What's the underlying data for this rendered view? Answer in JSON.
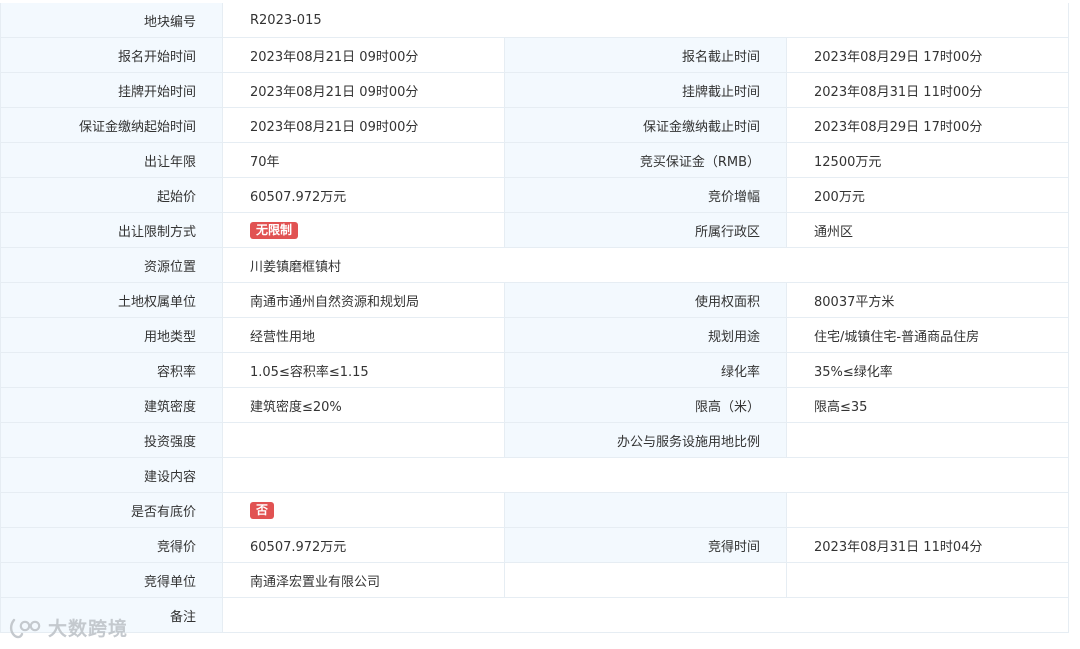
{
  "rows": [
    {
      "full": true,
      "label": "地块编号",
      "value": "R2023-015"
    },
    {
      "label": "报名开始时间",
      "value": "2023年08月21日 09时00分",
      "label2": "报名截止时间",
      "value2": "2023年08月29日 17时00分"
    },
    {
      "label": "挂牌开始时间",
      "value": "2023年08月21日 09时00分",
      "label2": "挂牌截止时间",
      "value2": "2023年08月31日 11时00分"
    },
    {
      "label": "保证金缴纳起始时间",
      "value": "2023年08月21日 09时00分",
      "label2": "保证金缴纳截止时间",
      "value2": "2023年08月29日 17时00分"
    },
    {
      "label": "出让年限",
      "value": "70年",
      "label2": "竞买保证金（RMB）",
      "value2": "12500万元"
    },
    {
      "label": "起始价",
      "value": "60507.972万元",
      "label2": "竞价增幅",
      "value2": "200万元"
    },
    {
      "label": "出让限制方式",
      "value": "无限制",
      "valueTag": true,
      "label2": "所属行政区",
      "value2": "通州区"
    },
    {
      "full": true,
      "label": "资源位置",
      "value": "川姜镇磨框镇村"
    },
    {
      "label": "土地权属单位",
      "value": "南通市通州自然资源和规划局",
      "label2": "使用权面积",
      "value2": "80037平方米"
    },
    {
      "label": "用地类型",
      "value": "经营性用地",
      "label2": "规划用途",
      "value2": "住宅/城镇住宅-普通商品住房"
    },
    {
      "label": "容积率",
      "value": "1.05≤容积率≤1.15",
      "label2": "绿化率",
      "value2": "35%≤绿化率"
    },
    {
      "label": "建筑密度",
      "value": "建筑密度≤20%",
      "label2": "限高（米）",
      "value2": "限高≤35"
    },
    {
      "label": "投资强度",
      "value": "",
      "label2": "办公与服务设施用地比例",
      "value2": ""
    },
    {
      "full": true,
      "label": "建设内容",
      "value": ""
    },
    {
      "label": "是否有底价",
      "value": "否",
      "valueTag": true,
      "label2": "",
      "value2": ""
    },
    {
      "label": "竞得价",
      "value": "60507.972万元",
      "label2": "竞得时间",
      "value2": "2023年08月31日 11时04分"
    },
    {
      "label": "竞得单位",
      "value": "南通泽宏置业有限公司",
      "label2": "",
      "value2": "",
      "plain2": true
    },
    {
      "full": true,
      "label": "备注",
      "value": ""
    }
  ],
  "colors": {
    "label_bg": "#f3f9fe",
    "border": "#e6edf3",
    "tag_bg": "#e15252",
    "text": "#333333"
  },
  "watermark": {
    "icon": "brand-logo-icon",
    "text": "大数跨境"
  }
}
